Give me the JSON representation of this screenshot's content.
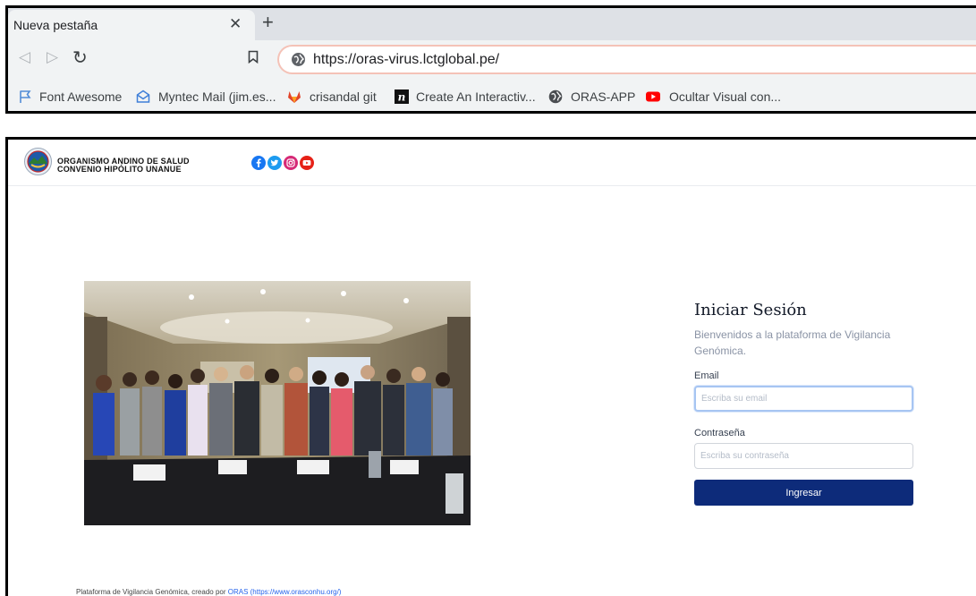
{
  "browser": {
    "tab": {
      "title": "Nueva pestaña",
      "close_icon": "close-icon"
    },
    "new_tab_icon": "plus-icon",
    "nav": {
      "back_icon": "back-arrow-icon",
      "forward_icon": "forward-arrow-icon",
      "reload_icon": "reload-icon"
    },
    "url": "https://oras-virus.lctglobal.pe/",
    "bookmarks": [
      {
        "label": "Font Awesome",
        "icon": "flag-icon",
        "color": "#528dd7"
      },
      {
        "label": "Myntec Mail (jim.es...",
        "icon": "mail-icon",
        "color": "#3f7fd8"
      },
      {
        "label": "crisandal git",
        "icon": "gitlab-icon",
        "color": "#e24329"
      },
      {
        "label": "Create An Interactiv...",
        "icon": "n-logo-icon",
        "color": "#111111"
      },
      {
        "label": "ORAS-APP",
        "icon": "globe-icon",
        "color": "#5f6368"
      },
      {
        "label": "Ocultar Visual con...",
        "icon": "youtube-icon",
        "color": "#ff0000"
      }
    ]
  },
  "site": {
    "org_line1": "ORGANISMO ANDINO DE SALUD",
    "org_line2": "CONVENIO HIPÓLITO UNANUE",
    "social_icons": [
      {
        "name": "facebook-icon",
        "color": "#1877f2"
      },
      {
        "name": "twitter-icon",
        "color": "#1d9bf0"
      },
      {
        "name": "instagram-icon",
        "color": "#d62976"
      },
      {
        "name": "youtube-icon",
        "color": "#e62117"
      }
    ]
  },
  "login": {
    "title": "Iniciar Sesión",
    "subtitle": "Bienvenidos a la plataforma de Vigilancia Genómica.",
    "email_label": "Email",
    "email_placeholder": "Escriba su email",
    "password_label": "Contraseña",
    "password_placeholder": "Escriba su contraseña",
    "submit_label": "Ingresar",
    "button_color": "#0d2b7a"
  },
  "footer": {
    "text": "Plataforma de Vigilancia Genómica, creado por ",
    "link_label": "ORAS (https://www.orasconhu.org/)"
  }
}
